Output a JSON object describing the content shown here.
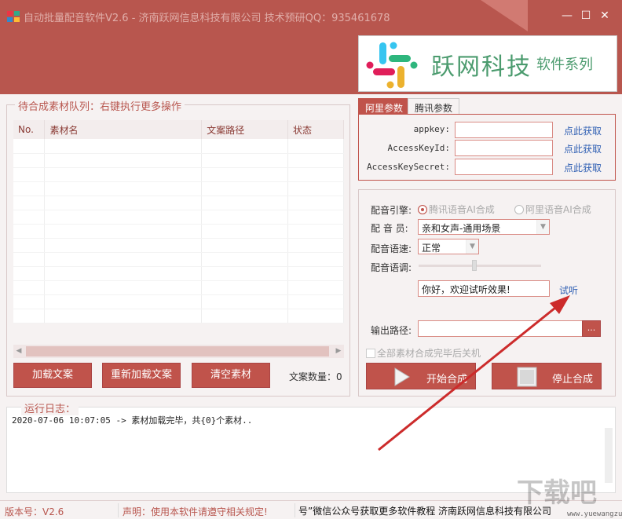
{
  "window": {
    "title": "自动批量配音软件V2.6 - 济南跃网信息科技有限公司 技术预研QQ：935461678",
    "minimize_glyph": "—",
    "maximize_glyph": "☐",
    "close_glyph": "✕"
  },
  "banner": {
    "brand": "跃网科技",
    "series": "软件系列"
  },
  "queue": {
    "group_title": "待合成素材队列：右键执行更多操作",
    "columns": [
      "No.",
      "素材名",
      "文案路径",
      "状态"
    ],
    "rows": [],
    "count_label": "文案数量：",
    "count_value": "0"
  },
  "buttons": {
    "load": "加载文案",
    "reload": "重新加载文案",
    "clear": "清空素材",
    "start": "开始合成",
    "stop": "停止合成",
    "listen": "试听",
    "browse": "..."
  },
  "tabs": [
    {
      "label": "阿里参数",
      "active": true
    },
    {
      "label": "腾讯参数",
      "active": false
    }
  ],
  "ali_params": {
    "fields": [
      {
        "label": "appkey:",
        "value": "",
        "link": "点此获取"
      },
      {
        "label": "AccessKeyId:",
        "value": "",
        "link": "点此获取"
      },
      {
        "label": "AccessKeySecret:",
        "value": "",
        "link": "点此获取"
      }
    ]
  },
  "settings": {
    "engine_label": "配音引擎:",
    "engine_options": [
      "腾讯语音AI合成",
      "阿里语音AI合成"
    ],
    "engine_selected": 0,
    "voice_label": "配 音 员:",
    "voice_value": "亲和女声-通用场景",
    "speed_label": "配音语速:",
    "speed_value": "正常",
    "pitch_label": "配音语调:",
    "pitch_level": 0.45,
    "preview_text": "你好，欢迎试听效果!",
    "output_label": "输出路径:",
    "output_value": "",
    "shutdown_label": "全部素材合成完毕后关机"
  },
  "log": {
    "title": "运行日志：",
    "lines": [
      "2020-07-06 10:07:05 -> 素材加载完毕，共{0}个素材.."
    ]
  },
  "status": {
    "version": "版本号：V2.6",
    "declaration": "声明：使用本软件请遵守相关规定!",
    "marquee": "号”微信公众号获取更多软件教程 济南跃网信息科技有限公司"
  },
  "watermark": {
    "text": "下载吧",
    "url": "www.yuewangzu"
  },
  "colors": {
    "accent": "#c0534b",
    "title_bg": "#b8564e",
    "link": "#2f5fb3",
    "brand_green": "#4b9b6e",
    "arrow": "#cc2b2b"
  }
}
